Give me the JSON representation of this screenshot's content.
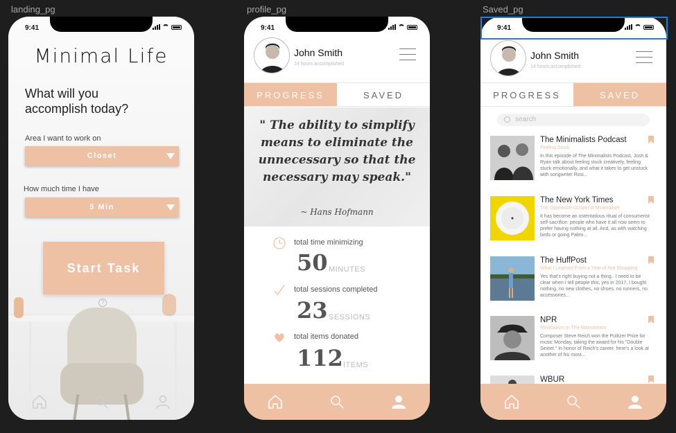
{
  "frames": {
    "landing_label": "landing_pg",
    "profile_label": "profile_pg",
    "saved_label": "Saved_pg"
  },
  "status": {
    "time": "9:41"
  },
  "landing": {
    "title": "Minimal Life",
    "question": "What will you accomplish today?",
    "area_label": "Area I want to work on",
    "area_value": "Closet",
    "time_label": "How much time I have",
    "time_value": "5 Min",
    "start_button": "Start Task",
    "help_glyph": "?"
  },
  "profile": {
    "name": "John Smith",
    "subtitle": "14 hours accomplished",
    "tabs": {
      "progress": "PROGRESS",
      "saved": "SAVED"
    },
    "quote": "\" The ability to simplify means to eliminate the unnecessary so that the necessary may speak.\"",
    "quote_author": "~ Hans Hofmann",
    "stats": [
      {
        "label": "total time minimizing",
        "value": "50",
        "unit": "MINUTES",
        "icon": "clock-icon"
      },
      {
        "label": "total sessions completed",
        "value": "23",
        "unit": "SESSIONS",
        "icon": "check-icon"
      },
      {
        "label": "total items donated",
        "value": "112",
        "unit": "ITEMS",
        "icon": "heart-icon"
      }
    ]
  },
  "saved": {
    "search_placeholder": "search",
    "items": [
      {
        "title": "The Minimalists Podcast",
        "subtitle": "Feeling Stuck",
        "desc": "In this episode of The Minimalists Podcast, Josh & Ryan talk about feeling stuck creatively, feeling stuck emotionally, and what it takes to get unstuck with songwriter Rosi..."
      },
      {
        "title": "The New York Times",
        "subtitle": "The Oppresive Gospel of Minimalism",
        "desc": "It has become an ostentatious ritual of consumerist self-sacrifice: people who have it all now seem to prefer having nothing at all. And, as with watching birds or going Paleo..."
      },
      {
        "title": "The HuffPost",
        "subtitle": "What I Learned From a Year of Not Shopping",
        "desc": "Yes that's right buying not a thing.. I need to be clear when I tell people this, yes in 2017, I bought nothing, no new clothes, no shoes, no runners, no accessories..."
      },
      {
        "title": "NPR",
        "subtitle": "Minimalism In The Mainstream",
        "desc": "Composer Steve Reich won the Pulitzer Prize for music Monday, taking the award for his \"Double Sextet.\" In honor of Reich's career, here's a look at another of his most..."
      },
      {
        "title": "WBUR",
        "subtitle": "",
        "desc": ""
      }
    ]
  },
  "colors": {
    "accent": "#eec0a4",
    "selection": "#1e7ee6"
  }
}
